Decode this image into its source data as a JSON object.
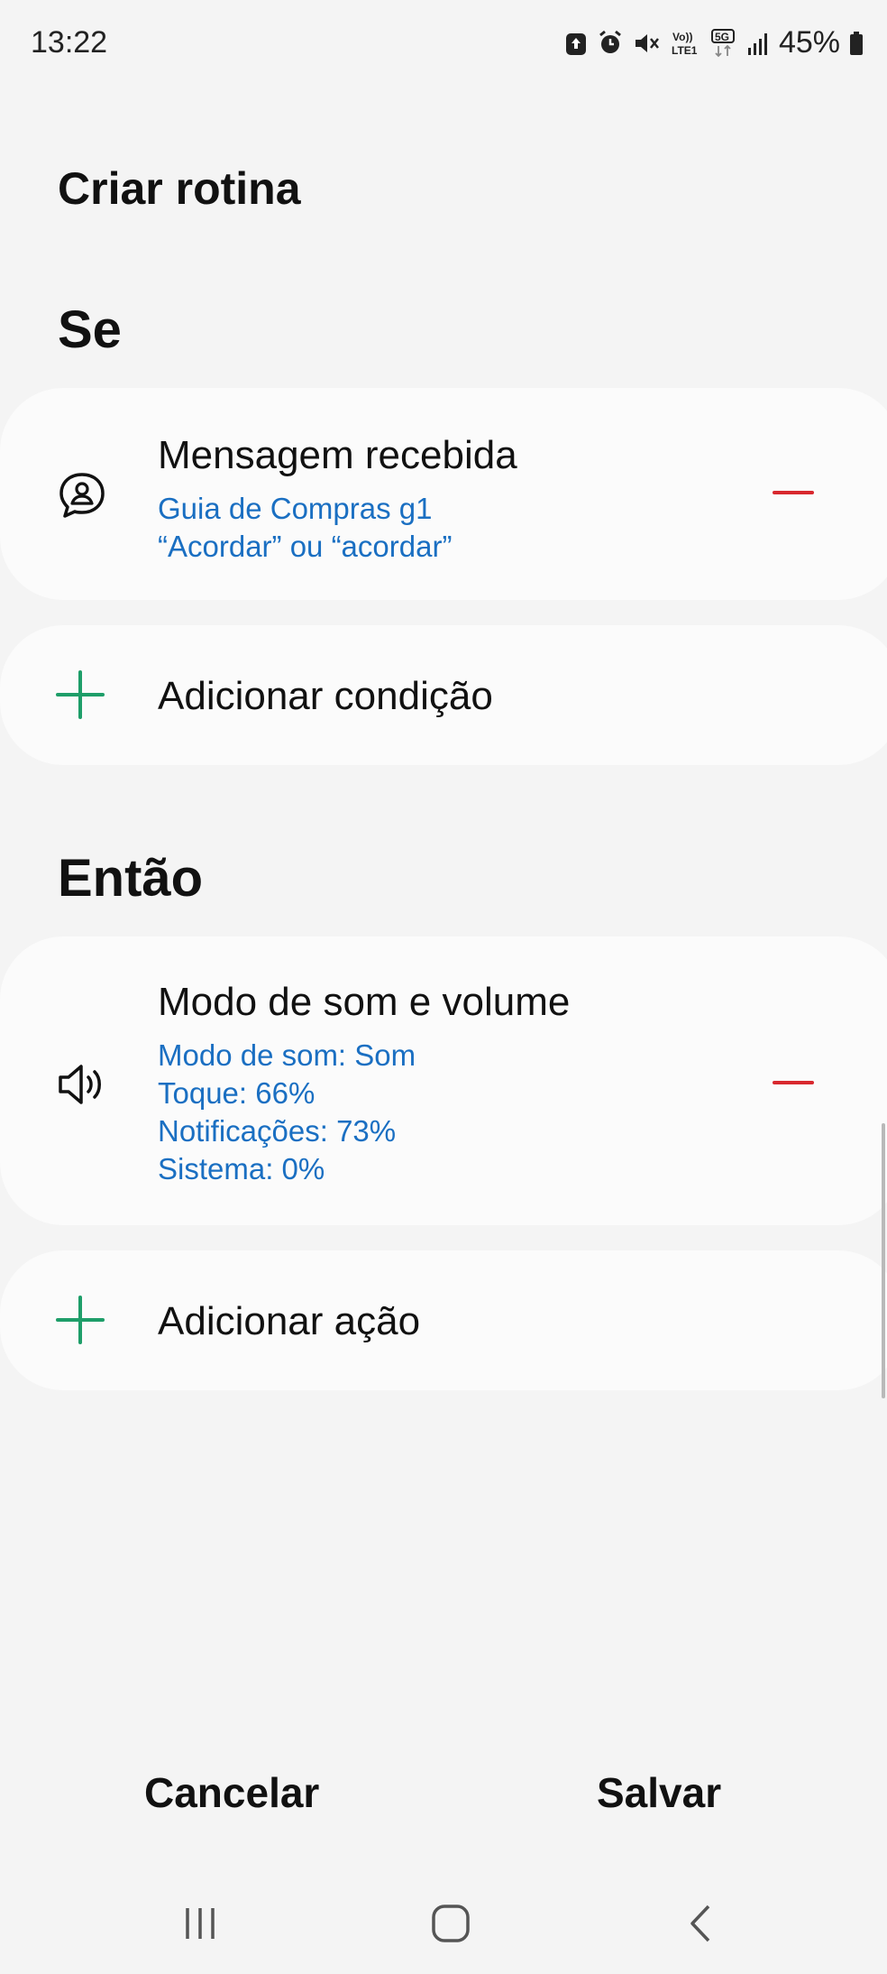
{
  "status_bar": {
    "time": "13:22",
    "battery_percent": "45%",
    "icons": [
      "upload-icon",
      "alarm-icon",
      "mute-icon",
      "volte-icon",
      "5g-icon",
      "signal-icon",
      "battery-icon"
    ],
    "volte_label": "Vo)) LTE1",
    "network_label": "5G"
  },
  "header": {
    "title": "Criar rotina"
  },
  "if_section": {
    "title": "Se",
    "condition": {
      "icon": "message-person-icon",
      "title": "Mensagem recebida",
      "line1": "Guia de Compras g1",
      "line2": "“Acordar” ou “acordar”"
    },
    "add_label": "Adicionar condição"
  },
  "then_section": {
    "title": "Então",
    "action": {
      "icon": "speaker-icon",
      "title": "Modo de som e volume",
      "details": [
        "Modo de som: Som",
        "Toque: 66%",
        "Notificações: 73%",
        "Sistema: 0%"
      ]
    },
    "add_label": "Adicionar ação"
  },
  "footer": {
    "cancel_label": "Cancelar",
    "save_label": "Salvar"
  },
  "nav": {
    "icons": [
      "recents-icon",
      "home-icon",
      "back-icon"
    ]
  },
  "colors": {
    "accent_blue": "#1a6fc2",
    "remove_red": "#d8282e",
    "add_green": "#1e9e69",
    "background": "#f4f4f4",
    "card": "#fbfbfb"
  }
}
